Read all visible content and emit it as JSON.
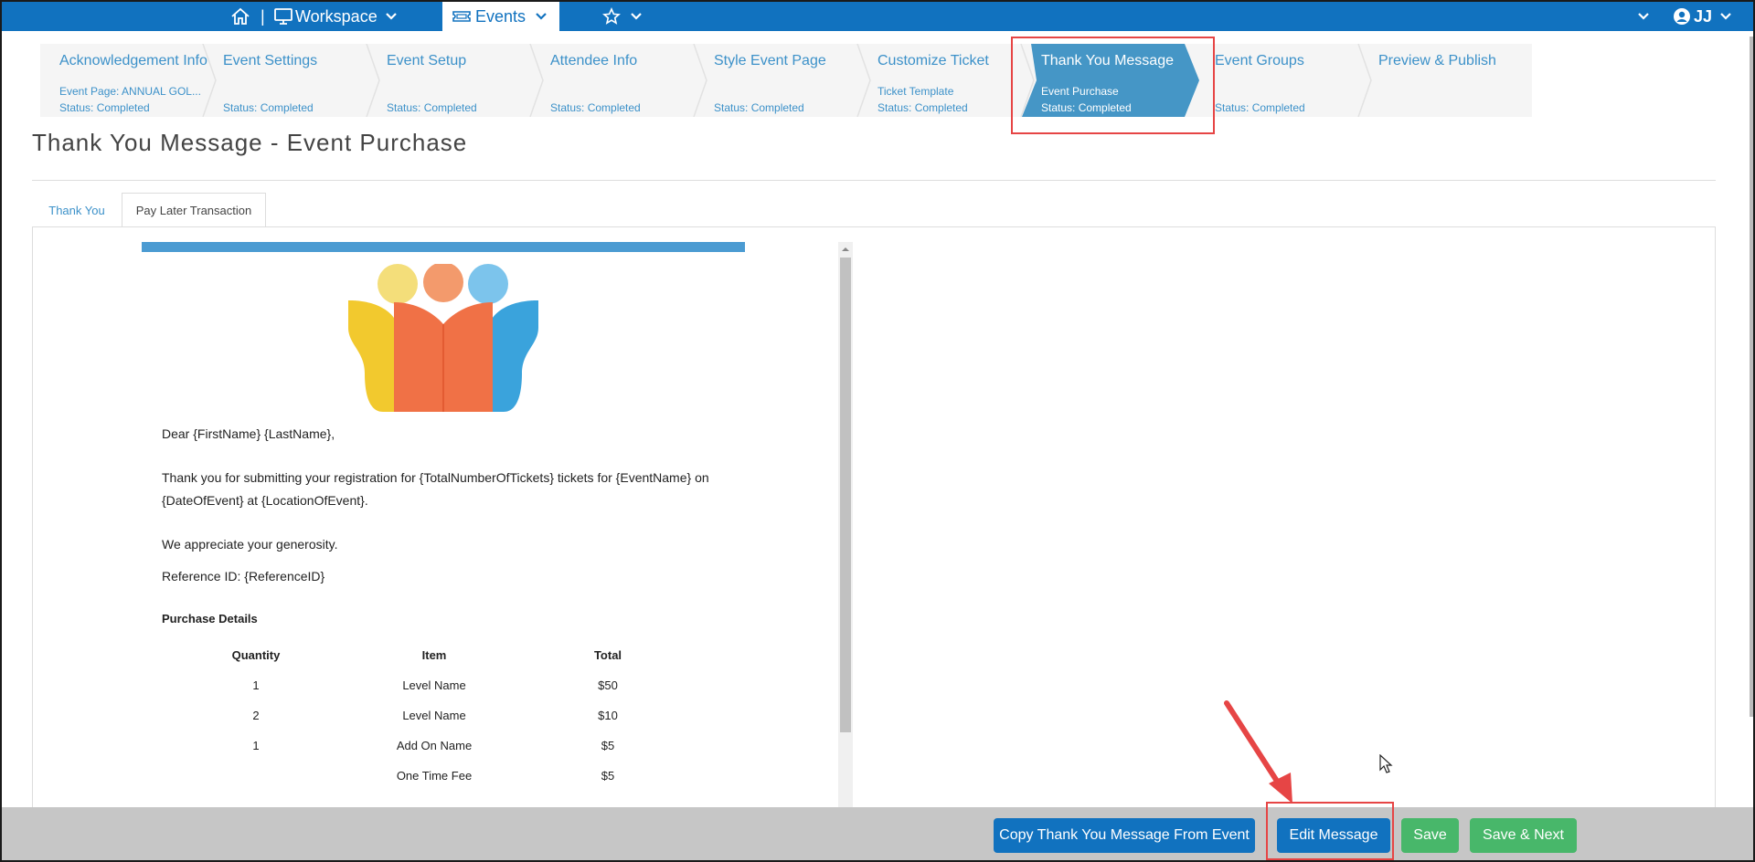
{
  "topbar": {
    "workspace_label": "Workspace",
    "events_label": "Events",
    "user_initials": "JJ",
    "separator": "|"
  },
  "wizard": {
    "steps": [
      {
        "title": "Acknowledgement Info",
        "sub": "Event Page: ANNUAL GOL...",
        "status": "Status: Completed"
      },
      {
        "title": "Event Settings",
        "sub": "",
        "status": "Status: Completed"
      },
      {
        "title": "Event Setup",
        "sub": "",
        "status": "Status: Completed"
      },
      {
        "title": "Attendee Info",
        "sub": "",
        "status": "Status: Completed"
      },
      {
        "title": "Style Event Page",
        "sub": "",
        "status": "Status: Completed"
      },
      {
        "title": "Customize Ticket",
        "sub": "Ticket Template",
        "status": "Status: Completed"
      },
      {
        "title": "Thank You Message",
        "sub": "Event Purchase",
        "status": "Status: Completed"
      },
      {
        "title": "Event Groups",
        "sub": "",
        "status": "Status: Completed"
      },
      {
        "title": "Preview & Publish",
        "sub": "",
        "status": ""
      }
    ]
  },
  "page": {
    "title": "Thank You Message - Event Purchase",
    "tabs": [
      "Thank You",
      "Pay Later Transaction"
    ]
  },
  "message": {
    "greeting": "Dear {FirstName} {LastName},",
    "body_line1": "Thank you for submitting your registration for {TotalNumberOfTickets} tickets for {EventName} on",
    "body_line2": "{DateOfEvent} at {LocationOfEvent}.",
    "appreciation": "We appreciate your generosity.",
    "reference": "Reference ID: {ReferenceID}",
    "purchase_heading": "Purchase Details",
    "table": {
      "headers": [
        "Quantity",
        "Item",
        "Total"
      ],
      "rows": [
        [
          "1",
          "Level Name",
          "$50"
        ],
        [
          "2",
          "Level Name",
          "$10"
        ],
        [
          "1",
          "Add On Name",
          "$5"
        ],
        [
          "",
          "One Time Fee",
          "$5"
        ]
      ]
    }
  },
  "footer": {
    "copy_button": "Copy Thank You Message From Event",
    "edit_button": "Edit Message",
    "save_button": "Save",
    "save_next_button": "Save & Next"
  },
  "colors": {
    "brand_blue": "#1172bf",
    "step_text": "#3c91c9",
    "active_step": "#4596c6",
    "save_green": "#48b76a",
    "highlight_red": "#e64545"
  }
}
